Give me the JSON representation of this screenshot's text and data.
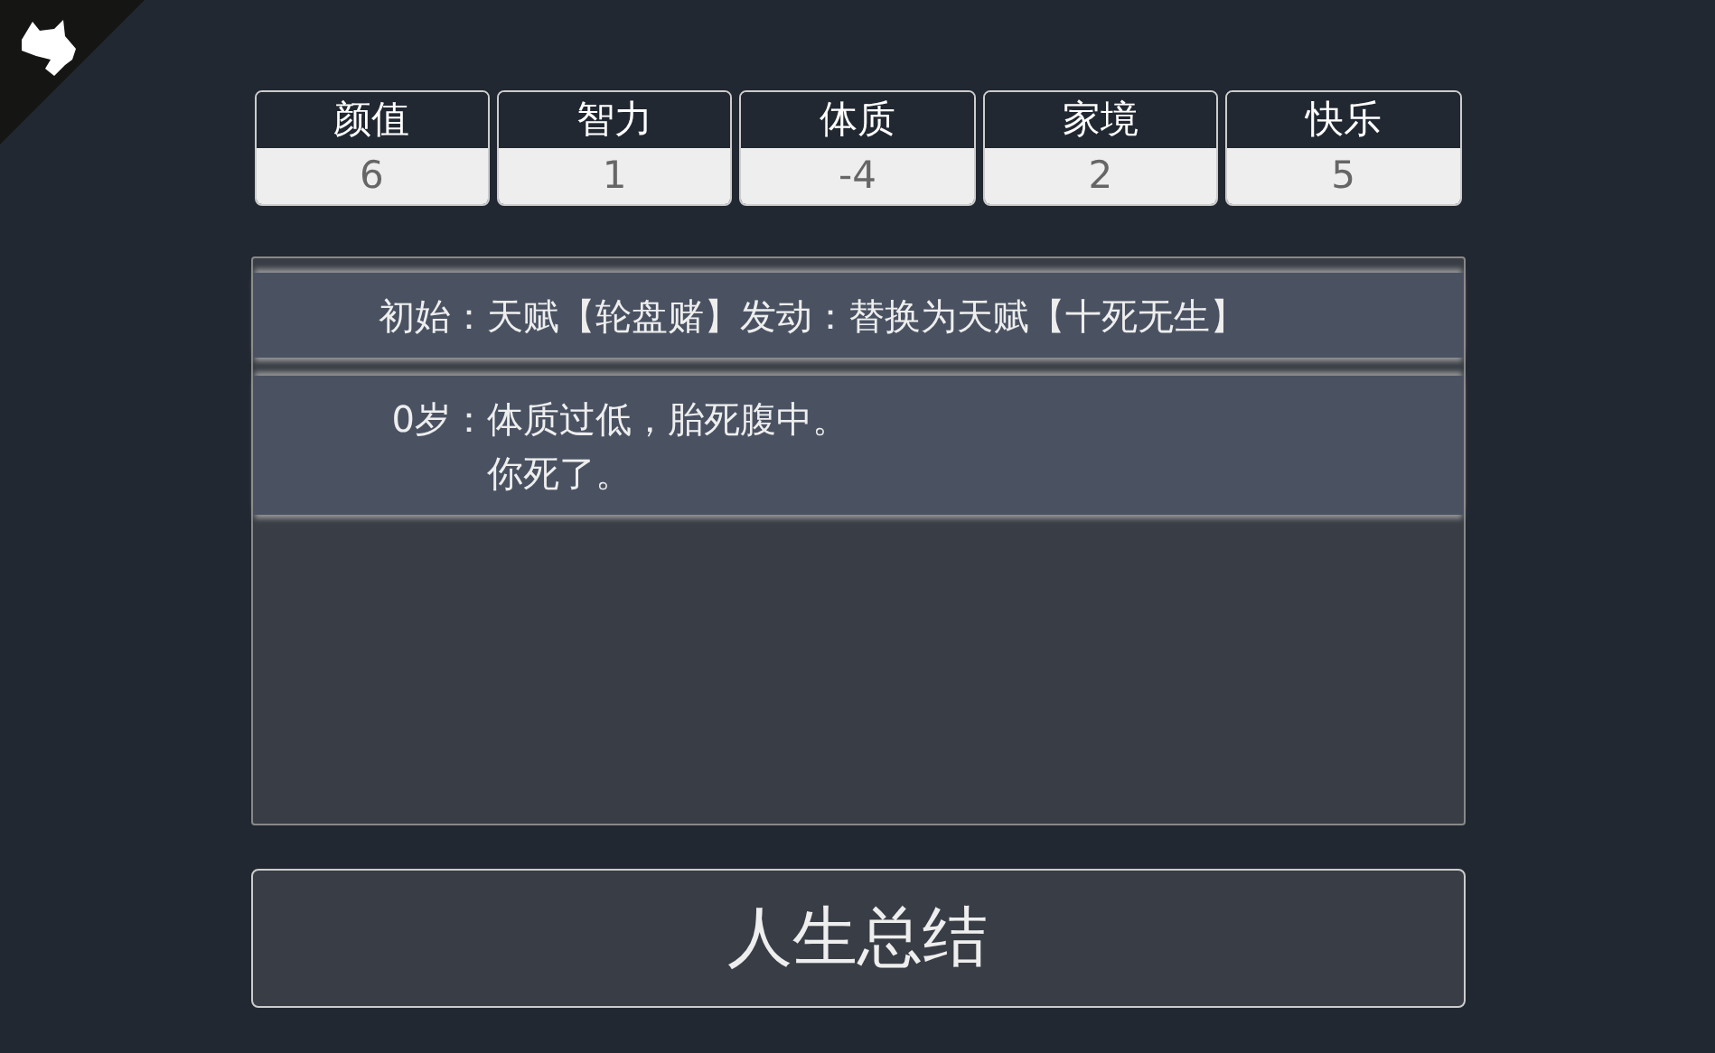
{
  "stats": [
    {
      "label": "颜值",
      "value": "6"
    },
    {
      "label": "智力",
      "value": "1"
    },
    {
      "label": "体质",
      "value": "-4"
    },
    {
      "label": "家境",
      "value": "2"
    },
    {
      "label": "快乐",
      "value": "5"
    }
  ],
  "log": [
    {
      "label": "初始：",
      "lines": [
        "天赋【轮盘赌】发动：替换为天赋【十死无生】"
      ]
    },
    {
      "label": "0岁：",
      "lines": [
        "体质过低，胎死腹中。",
        "你死了。"
      ]
    }
  ],
  "summary_button": "人生总结"
}
